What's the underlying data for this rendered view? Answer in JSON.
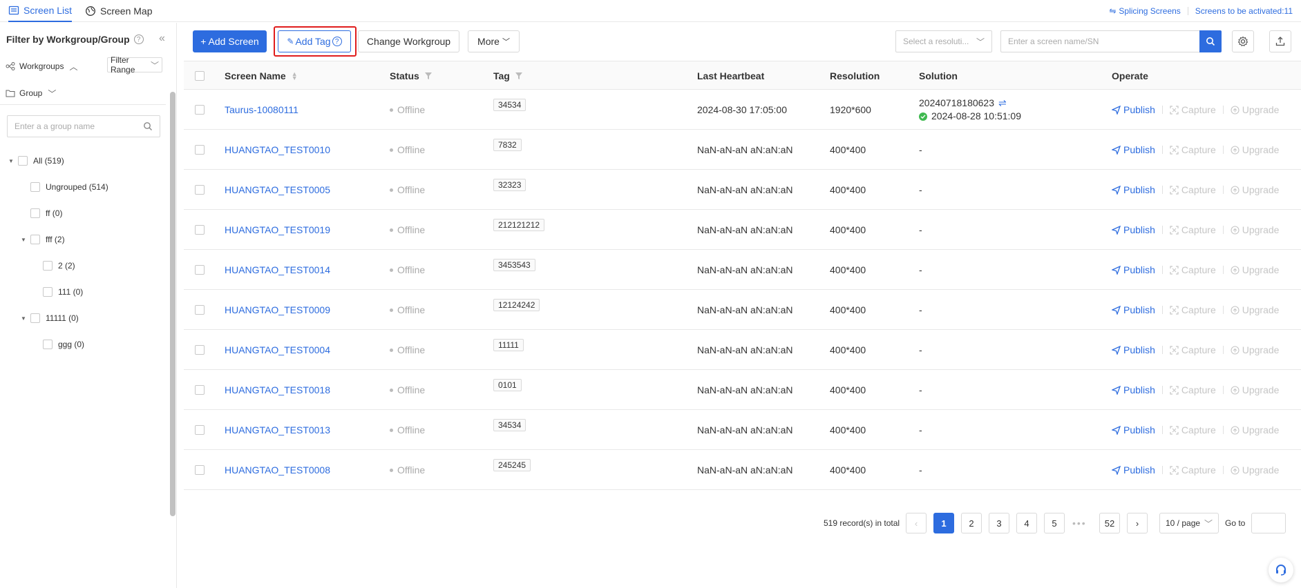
{
  "top_tabs": [
    {
      "label": "Screen List",
      "icon": "list-icon",
      "active": true
    },
    {
      "label": "Screen Map",
      "icon": "map-icon",
      "active": false
    }
  ],
  "top_right": {
    "splicing": "Splicing Screens",
    "activated": "Screens to be activated:11"
  },
  "sidebar": {
    "title": "Filter by Workgroup/Group",
    "workgroups_label": "Workgroups",
    "filter_range": "Filter Range",
    "group_label": "Group",
    "search_placeholder": "Enter a a group name",
    "tree": [
      {
        "label": "All (519)"
      },
      {
        "label": "Ungrouped (514)"
      },
      {
        "label": "ff (0)"
      },
      {
        "label": "fff (2)"
      },
      {
        "label": "2 (2)"
      },
      {
        "label": "111 (0)"
      },
      {
        "label": "11111 (0)"
      },
      {
        "label": "ggg (0)"
      }
    ]
  },
  "toolbar": {
    "add_screen": "+ Add Screen",
    "add_tag": "Add Tag",
    "change_workgroup": "Change Workgroup",
    "more": "More",
    "resolution_placeholder": "Select a resoluti...",
    "search_placeholder": "Enter a screen name/SN"
  },
  "columns": {
    "name": "Screen Name",
    "status": "Status",
    "tag": "Tag",
    "heartbeat": "Last Heartbeat",
    "resolution": "Resolution",
    "solution": "Solution",
    "operate": "Operate"
  },
  "ops": {
    "publish": "Publish",
    "capture": "Capture",
    "upgrade": "Upgrade"
  },
  "rows": [
    {
      "name": "Taurus-10080111",
      "status": "Offline",
      "tag": "34534",
      "heartbeat": "2024-08-30 17:05:00",
      "resolution": "1920*600",
      "solution": "20240718180623",
      "solution_time": "2024-08-28 10:51:09"
    },
    {
      "name": "HUANGTAO_TEST0010",
      "status": "Offline",
      "tag": "7832",
      "heartbeat": "NaN-aN-aN aN:aN:aN",
      "resolution": "400*400",
      "solution": "-"
    },
    {
      "name": "HUANGTAO_TEST0005",
      "status": "Offline",
      "tag": "32323",
      "heartbeat": "NaN-aN-aN aN:aN:aN",
      "resolution": "400*400",
      "solution": "-"
    },
    {
      "name": "HUANGTAO_TEST0019",
      "status": "Offline",
      "tag": "212121212",
      "heartbeat": "NaN-aN-aN aN:aN:aN",
      "resolution": "400*400",
      "solution": "-"
    },
    {
      "name": "HUANGTAO_TEST0014",
      "status": "Offline",
      "tag": "3453543",
      "heartbeat": "NaN-aN-aN aN:aN:aN",
      "resolution": "400*400",
      "solution": "-"
    },
    {
      "name": "HUANGTAO_TEST0009",
      "status": "Offline",
      "tag": "12124242",
      "heartbeat": "NaN-aN-aN aN:aN:aN",
      "resolution": "400*400",
      "solution": "-"
    },
    {
      "name": "HUANGTAO_TEST0004",
      "status": "Offline",
      "tag": "11111",
      "heartbeat": "NaN-aN-aN aN:aN:aN",
      "resolution": "400*400",
      "solution": "-"
    },
    {
      "name": "HUANGTAO_TEST0018",
      "status": "Offline",
      "tag": "0101",
      "heartbeat": "NaN-aN-aN aN:aN:aN",
      "resolution": "400*400",
      "solution": "-"
    },
    {
      "name": "HUANGTAO_TEST0013",
      "status": "Offline",
      "tag": "34534",
      "heartbeat": "NaN-aN-aN aN:aN:aN",
      "resolution": "400*400",
      "solution": "-"
    },
    {
      "name": "HUANGTAO_TEST0008",
      "status": "Offline",
      "tag": "245245",
      "heartbeat": "NaN-aN-aN aN:aN:aN",
      "resolution": "400*400",
      "solution": "-"
    }
  ],
  "pagination": {
    "total": "519 record(s) in total",
    "pages": [
      "1",
      "2",
      "3",
      "4",
      "5"
    ],
    "ellipsis": "•••",
    "last": "52",
    "per_page": "10 / page",
    "goto": "Go to"
  },
  "colors": {
    "primary": "#2d6cdf",
    "highlight": "#e01c1c",
    "success": "#3fb950"
  }
}
